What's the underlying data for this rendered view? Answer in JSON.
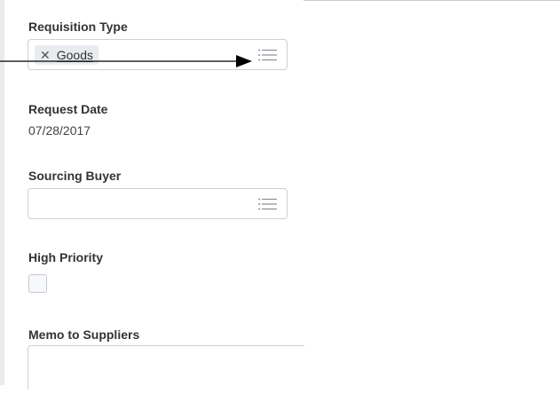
{
  "form": {
    "requisition_type": {
      "label": "Requisition Type",
      "selected_value": "Goods",
      "remove_icon": "close-icon",
      "list_icon": "list-icon"
    },
    "request_date": {
      "label": "Request Date",
      "value": "07/28/2017"
    },
    "sourcing_buyer": {
      "label": "Sourcing Buyer",
      "value": "",
      "list_icon": "list-icon"
    },
    "high_priority": {
      "label": "High Priority",
      "checked": false
    },
    "memo_to_suppliers": {
      "label": "Memo to Suppliers",
      "value": ""
    }
  },
  "annotation": {
    "type": "arrow",
    "color": "#000000",
    "target": "requisition-type-list-icon"
  },
  "colors": {
    "border": "#ced0d4",
    "pill_background": "#e8ecef",
    "label_text": "#333333"
  }
}
